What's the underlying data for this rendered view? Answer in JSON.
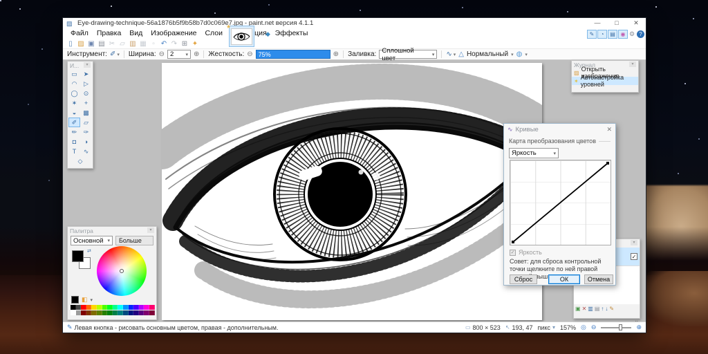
{
  "window": {
    "title": "Eye-drawing-technique-56a1876b5f9b58b7d0c069e7.jpg - paint.net версия 4.1.1",
    "app_icon_glyph": "▨",
    "minimize_glyph": "—",
    "maximize_glyph": "□",
    "close_glyph": "✕"
  },
  "menu": {
    "items": [
      {
        "name": "menu-file",
        "label": "Файл"
      },
      {
        "name": "menu-edit",
        "label": "Правка"
      },
      {
        "name": "menu-view",
        "label": "Вид"
      },
      {
        "name": "menu-image",
        "label": "Изображение"
      },
      {
        "name": "menu-layers",
        "label": "Слои"
      },
      {
        "name": "menu-adjustments",
        "label": "Коррекция"
      },
      {
        "name": "menu-effects",
        "label": "Эффекты"
      }
    ]
  },
  "image_tab": {
    "unsaved_star": "★",
    "more_glyph": "◆"
  },
  "file_toolbar": {
    "icons": [
      {
        "name": "new-file-icon",
        "glyph": "▯",
        "color": "#5b87b5"
      },
      {
        "name": "open-file-icon",
        "glyph": "▨",
        "color": "#d8a24a"
      },
      {
        "name": "save-icon",
        "glyph": "▣",
        "color": "#6f87b0"
      },
      {
        "name": "print-icon",
        "glyph": "▤",
        "color": "#8a8f98"
      },
      {
        "name": "cut-icon",
        "glyph": "✂",
        "color": "#c2c7cd"
      },
      {
        "name": "copy-icon",
        "glyph": "▱",
        "color": "#c2c7cd"
      },
      {
        "name": "paste-icon",
        "glyph": "▥",
        "color": "#caa06a"
      },
      {
        "name": "crop-icon",
        "glyph": "▦",
        "color": "#c8cdd3"
      },
      {
        "name": "deselect-icon",
        "glyph": "▫",
        "color": "#c8cdd3"
      },
      {
        "name": "undo-icon",
        "glyph": "↶",
        "color": "#4f86c6"
      },
      {
        "name": "redo-icon",
        "glyph": "↷",
        "color": "#bfc4ca"
      },
      {
        "name": "crop-to-selection-icon",
        "glyph": "⊞",
        "color": "#8a8f98"
      },
      {
        "name": "finish-icon",
        "glyph": "✦",
        "color": "#e2a23c"
      }
    ]
  },
  "window_toggles": {
    "buttons": [
      {
        "name": "toggle-tools-window-button",
        "glyph": "✎",
        "color": "#3b6ea5"
      },
      {
        "name": "toggle-history-window-button",
        "glyph": "◔",
        "color": "#3b6ea5"
      },
      {
        "name": "toggle-layers-window-button",
        "glyph": "▤",
        "color": "#3b6ea5"
      },
      {
        "name": "toggle-colors-window-button",
        "glyph": "◉",
        "color": "#c05ab0"
      }
    ],
    "settings_glyph": "⚙",
    "help_glyph": "?"
  },
  "tool_options": {
    "tool_label": "Инструмент:",
    "tool_glyph": "✐",
    "caret": "▾",
    "minus_glyph": "⊖",
    "plus_glyph": "⊕",
    "width_label": "Ширина:",
    "width_value": "2",
    "hardness_label": "Жесткость:",
    "hardness_value": "75%",
    "fill_label": "Заливка:",
    "fill_value": "Сплошной цвет",
    "antialias_glyph": "∿",
    "quality_glyph": "△",
    "blend_value": "Нормальный",
    "clip_glyph": "◍"
  },
  "tools_window": {
    "title": "И...",
    "tools": [
      {
        "name": "rectangle-select-tool",
        "glyph": "▭"
      },
      {
        "name": "move-selected-pixels-tool",
        "glyph": "➤"
      },
      {
        "name": "lasso-select-tool",
        "glyph": "◠"
      },
      {
        "name": "move-selection-tool",
        "glyph": "▷"
      },
      {
        "name": "ellipse-select-tool",
        "glyph": "◯"
      },
      {
        "name": "zoom-tool",
        "glyph": "⊙"
      },
      {
        "name": "magic-wand-tool",
        "glyph": "✶"
      },
      {
        "name": "pan-tool",
        "glyph": "+"
      },
      {
        "name": "paint-bucket-tool",
        "glyph": "◒"
      },
      {
        "name": "gradient-tool",
        "glyph": "▩"
      },
      {
        "name": "paintbrush-tool",
        "glyph": "✐",
        "selected": true
      },
      {
        "name": "eraser-tool",
        "glyph": "▱"
      },
      {
        "name": "pencil-tool",
        "glyph": "✏"
      },
      {
        "name": "color-picker-tool",
        "glyph": "✑"
      },
      {
        "name": "clone-stamp-tool",
        "glyph": "◘"
      },
      {
        "name": "recolor-tool",
        "glyph": "◑"
      },
      {
        "name": "text-tool",
        "glyph": "T"
      },
      {
        "name": "line-curve-tool",
        "glyph": "∿"
      },
      {
        "name": "shapes-tool",
        "glyph": "◇"
      }
    ]
  },
  "history_window": {
    "title": "Журнал",
    "items": [
      {
        "label": "Открыть изображение",
        "icon": "▨"
      },
      {
        "label": "Автонастройка уровней",
        "icon": "✶"
      }
    ]
  },
  "palette_window": {
    "title": "Палитра",
    "mode_value": "Основной",
    "more_label": "Больше >>",
    "swap_glyph": "⇄",
    "swatches_row1": [
      "#000000",
      "#464646",
      "#ff0000",
      "#ff6a00",
      "#ffd800",
      "#b6ff00",
      "#4cff00",
      "#00ff21",
      "#00ff90",
      "#00ffff",
      "#0094ff",
      "#0026ff",
      "#4800ff",
      "#b200ff",
      "#ff00dc",
      "#ff006e"
    ],
    "swatches_row2": [
      "#ffffff",
      "#9b9b9b",
      "#7f0000",
      "#7f3300",
      "#7f6a00",
      "#5b7f00",
      "#267f00",
      "#007f0e",
      "#007f46",
      "#007f7f",
      "#004a7f",
      "#00137f",
      "#21007f",
      "#57007f",
      "#7f006e",
      "#7f0037"
    ]
  },
  "layers_window": {
    "check_glyph": "✓",
    "toolbar_icons": [
      {
        "name": "add-layer-icon",
        "glyph": "▣",
        "color": "#4f9a4f"
      },
      {
        "name": "delete-layer-icon",
        "glyph": "✕",
        "color": "#b05050"
      },
      {
        "name": "duplicate-layer-icon",
        "glyph": "▥",
        "color": "#3b6ea5"
      },
      {
        "name": "merge-layer-down-icon",
        "glyph": "▤",
        "color": "#8a8f98"
      },
      {
        "name": "move-layer-up-icon",
        "glyph": "↑",
        "color": "#3b6ea5"
      },
      {
        "name": "move-layer-down-icon",
        "glyph": "↓",
        "color": "#3b6ea5"
      },
      {
        "name": "layer-properties-icon",
        "glyph": "✎",
        "color": "#c08a3c"
      }
    ]
  },
  "curves_dialog": {
    "title": "Кривые",
    "icon_glyph": "∿",
    "close_glyph": "✕",
    "map_label": "Карта преобразования цветов",
    "channel_value": "Яркость",
    "luminosity_label": "Яркость",
    "check_glyph": "✓",
    "tip_text": "Совет: для сброса контрольной точки щелкните по ней правой кнопкой мыши.",
    "reset_label": "Сброс",
    "ok_label": "ОК",
    "cancel_label": "Отмена",
    "curve_points": [
      [
        0,
        0
      ],
      [
        255,
        255
      ]
    ]
  },
  "status_bar": {
    "hint": "Левая кнопка - рисовать основным цветом, правая - дополнительным.",
    "image_size": "800 × 523",
    "cursor_pos": "193, 47",
    "units": "пикс",
    "zoom": "157%"
  },
  "colors": {
    "accent_blue": "#2d8ceb",
    "selection_blue": "#cde8ff",
    "workspace_gray": "#bfbfbf"
  }
}
